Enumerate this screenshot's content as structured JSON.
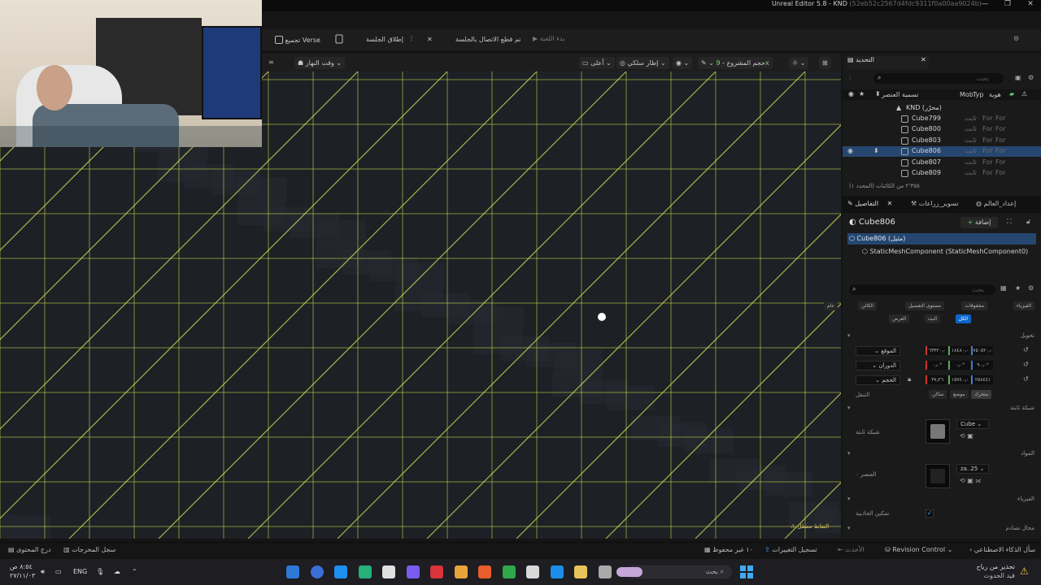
{
  "window": {
    "title": "Unreal Editor 5.8 - KND",
    "title_hash": "(52eb52c2567d4fdc9311f0a00aa9024b)",
    "controls": [
      "—",
      "❐",
      "✕"
    ]
  },
  "toolbar": {
    "verse": "تجميع Verse",
    "launch_session": "إطلاق الجلسة",
    "session_disconnected": "تم قطع الاتصال بالجلسة",
    "start_game": "بدء اللعبة"
  },
  "viewport_toolbar": {
    "time_of_day": "وقت النهار",
    "top": "أعلى",
    "wireframe": "إطار سلكي",
    "project_size_label": "حجم المشروع",
    "project_size_value": "9x"
  },
  "outliner": {
    "tab": "التحديد",
    "search_placeholder": "بحث",
    "col_label": "تسمية العنصر",
    "col_mob": "Mob",
    "col_type": "Typ",
    "col_id": "هوية",
    "root": "KND (محرّر)",
    "rows": [
      {
        "name": "Cube799",
        "type": "ثابت",
        "mob": "For",
        "mob2": "For"
      },
      {
        "name": "Cube800",
        "type": "ثابت",
        "mob": "For",
        "mob2": "For"
      },
      {
        "name": "Cube803",
        "type": "ثابت",
        "mob": "For",
        "mob2": "For"
      },
      {
        "name": "Cube806",
        "type": "ثابت",
        "mob": "For",
        "mob2": "For",
        "selected": true
      },
      {
        "name": "Cube807",
        "type": "ثابت",
        "mob": "For",
        "mob2": "For"
      },
      {
        "name": "Cube809",
        "type": "ثابت",
        "mob": "For",
        "mob2": "For"
      }
    ],
    "footer": "٢٬٣٥٥ من الكائنات (المحدد ١)"
  },
  "details": {
    "tabs": [
      "التفاصيل",
      "تسوير_زراعات",
      "إعداد_العالم"
    ],
    "object_name": "Cube806",
    "add_button": "إضافة",
    "instance_label": "Cube806 (مثيل)",
    "component_label": "StaticMeshComponent (StaticMeshComponent0)",
    "search_placeholder": "بحث",
    "filters_row1": [
      "الفيزياء",
      "مجفوفات",
      "مستوى التفصيل",
      "الكائن",
      "عام"
    ],
    "filters_row2": [
      "الكل",
      "البث",
      "العرض"
    ],
    "sections": {
      "transform": "تحويل",
      "static_mesh": "شبكة ثابتة",
      "materials": "المواد",
      "physics": "الفيزياء",
      "collision": "مجال تصادم"
    },
    "transform": {
      "location_label": "الموقع",
      "rotation_label": "الدوران",
      "scale_label": "الحجم",
      "location": [
        "٧٥٠٥٢٠٫٠",
        "١٨٤٨٠٫٠",
        "٦٣٣٢٠٫٠"
      ],
      "rotation": [
        "٩٠٫٠°",
        "٠٫٠°",
        "٠٫٠°"
      ],
      "scale": [
        "٢٥٨٤٤١",
        "١٥٧٤٠٫٠",
        "٣٧٫٢٦"
      ],
      "mobility_label": "التنقل",
      "mobility": [
        "متحرك",
        "موضع",
        "ساكن"
      ]
    },
    "static_mesh_label": "شبكة ثابتة",
    "static_mesh_value": "Cube",
    "material_label": "العنصر ٠",
    "material_value": "za..25",
    "gravity_label": "تمكين الجاذبية"
  },
  "viewport_badge": "التقاط معطل",
  "statusbar": {
    "content_drawer": "درج المحتوى",
    "output_log": "سجل المخرجات",
    "unsaved": "١٠ غير محفوظ",
    "change_log": "تسجيل التغييرات",
    "latest": "الأحدث",
    "revision_control": "Revision Control",
    "ai": "سأل الذكاء الاصطناعي"
  },
  "taskbar": {
    "time": "٨:٥٤ ص",
    "date": "٢٧/١١/٠٣",
    "lang": "ENG",
    "search_placeholder": "بحث",
    "weather_line1": "تحذير من رياح",
    "weather_line2": "قيد الحدوث"
  }
}
